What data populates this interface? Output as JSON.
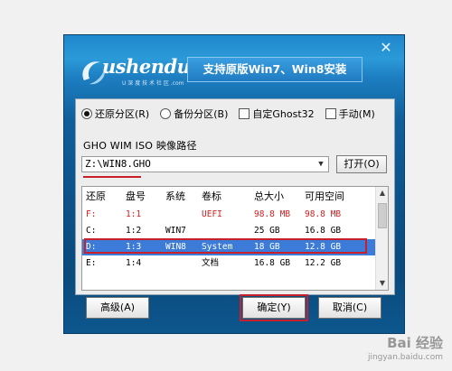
{
  "window": {
    "close_glyph": "✕",
    "logo_text": "ushendu",
    "logo_sub": "U 深 度 技 术 社 区 .com",
    "title": "支持原版Win7、Win8安装"
  },
  "options": [
    {
      "label": "还原分区(R)",
      "type": "radio",
      "checked": true
    },
    {
      "label": "备份分区(B)",
      "type": "radio",
      "checked": false
    },
    {
      "label": "自定Ghost32",
      "type": "checkbox",
      "checked": false
    },
    {
      "label": "手动(M)",
      "type": "checkbox",
      "checked": false
    }
  ],
  "path": {
    "label": "GHO WIM ISO 映像路径",
    "value": "Z:\\WIN8.GHO",
    "open_button": "打开(O)"
  },
  "table": {
    "headers": [
      "还原",
      "盘号",
      "系统",
      "卷标",
      "总大小",
      "可用空间"
    ],
    "rows": [
      [
        "F:",
        "1:1",
        "",
        "UEFI",
        "98.8 MB",
        "98.8 MB"
      ],
      [
        "C:",
        "1:2",
        "WIN7",
        "",
        "25 GB",
        "16.8 GB"
      ],
      [
        "D:",
        "1:3",
        "WIN8",
        "System",
        "18 GB",
        "12.8 GB"
      ],
      [
        "E:",
        "1:4",
        "",
        "文档",
        "16.8 GB",
        "12.2 GB"
      ]
    ],
    "selected_row": 2,
    "red_row": 0
  },
  "buttons": {
    "advanced": "高级(A)",
    "ok": "确定(Y)",
    "cancel": "取消(C)"
  },
  "watermark": {
    "main": "Bai 经验",
    "sub": "jingyan.baidu.com"
  },
  "colors": {
    "accent_red": "#c8202a",
    "selection": "#3c7bd8",
    "window_blue": "#0f5f9b"
  }
}
